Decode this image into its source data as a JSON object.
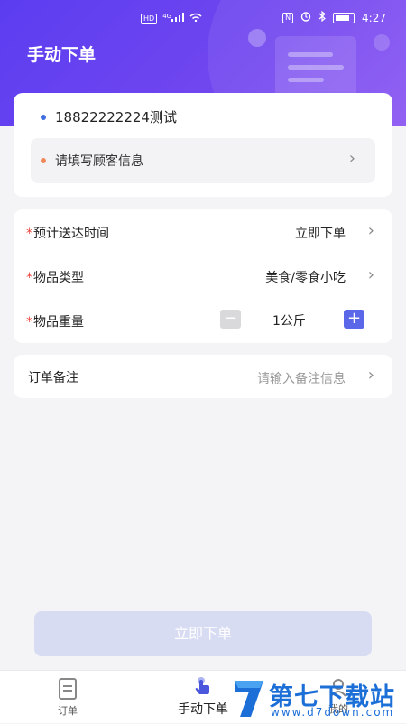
{
  "status_bar": {
    "network": "HD",
    "signal": "4G",
    "time": "4:27"
  },
  "header": {
    "title": "手动下单"
  },
  "customer": {
    "phone": "18822222224测试",
    "info_placeholder": "请填写顾客信息"
  },
  "order_form": {
    "delivery_time": {
      "label": "预计送达时间",
      "value": "立即下单"
    },
    "item_type": {
      "label": "物品类型",
      "value": "美食/零食小吃"
    },
    "item_weight": {
      "label": "物品重量",
      "value": "1公斤",
      "minus": "−",
      "plus": "+"
    }
  },
  "note": {
    "label": "订单备注",
    "placeholder": "请输入备注信息"
  },
  "submit_label": "立即下单",
  "tabbar": {
    "items": [
      {
        "label": "订单"
      },
      {
        "label": "手动下单"
      },
      {
        "label": "我的"
      }
    ]
  },
  "watermark": {
    "title": "第七下载站",
    "url": "www.d7down.com"
  },
  "colors": {
    "brand_purple": "#6a44f0",
    "accent_blue": "#5a67e8",
    "required_red": "#e8453c",
    "submit_disabled": "#d8dcf3"
  }
}
